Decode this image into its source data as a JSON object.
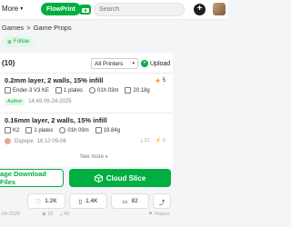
{
  "nav": {
    "more_label": "More",
    "flowprint_label": "FlowPrint",
    "search_placeholder": "Search"
  },
  "breadcrumb": {
    "item1": "Games",
    "separator": ">",
    "item2": "Game Props"
  },
  "follow_label": "Follow",
  "profiles": {
    "count": "(10)",
    "printer_select": "All Printers",
    "upload_label": "Upload",
    "items": [
      {
        "title": "0.2mm layer, 2 walls, 15% infill",
        "printer": "Ender-3 V3 KE",
        "plates": "1 plates",
        "time": "01h 03m",
        "weight": "20.18g",
        "badge": "Author",
        "date": "14:49 06-24-2025",
        "rating": "5"
      },
      {
        "title": "0.16mm layer, 2 walls, 15% infill",
        "printer": "K2",
        "plates": "1 plates",
        "time": "01h 09m",
        "weight": "19.84g",
        "user": "Dspope",
        "date": "16:10 09-06",
        "downloads": "21",
        "boosts": "0"
      }
    ],
    "see_more": "See more"
  },
  "actions": {
    "download_label": "age Download Files",
    "cloud_label": "Cloud Slice"
  },
  "stats": {
    "likes": "1.2K",
    "collects": "1.4K",
    "comments": "82"
  },
  "footer": {
    "date": "-24-2025",
    "views": "25",
    "downloads": "43",
    "report": "Report"
  },
  "colors": {
    "accent": "#00ae42",
    "star": "#ff8c1a"
  }
}
